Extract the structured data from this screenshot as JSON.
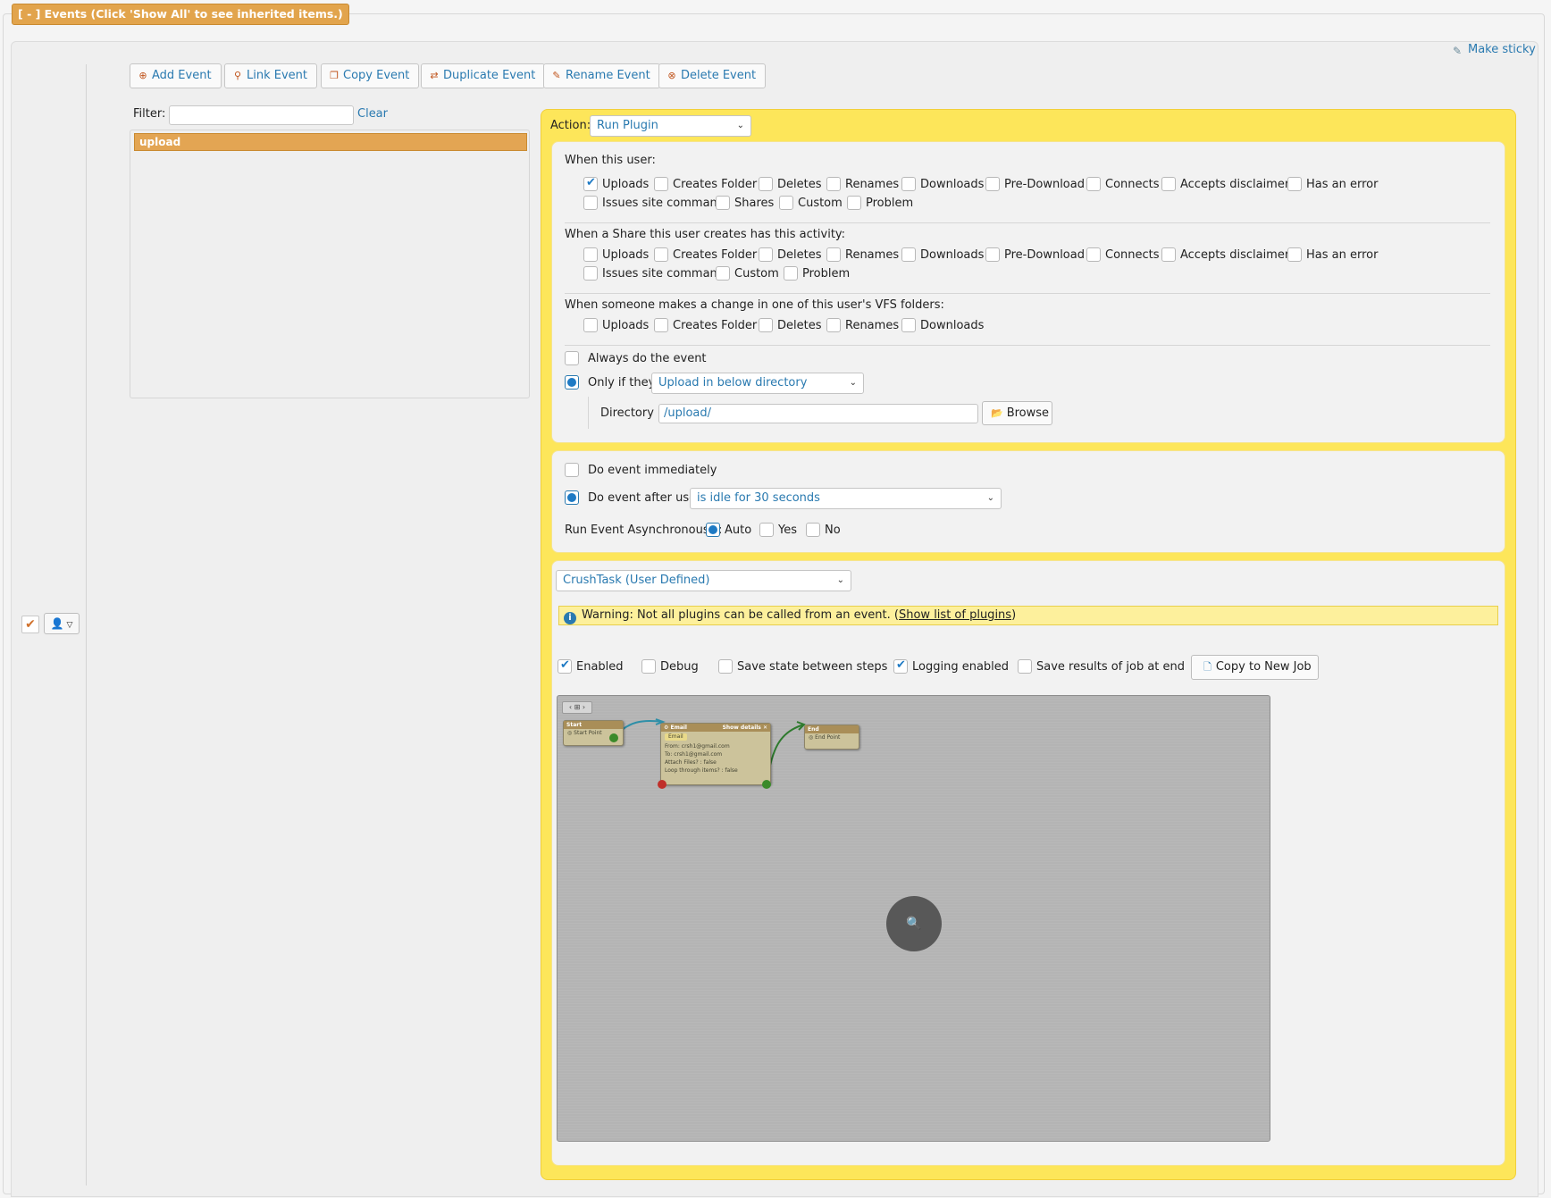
{
  "section": {
    "header": "[ - ] Events (Click 'Show All' to see inherited items.)",
    "make_sticky": "Make sticky"
  },
  "toolbar": {
    "add_event": "Add Event",
    "link_event": "Link Event",
    "copy_event": "Copy Event",
    "duplicate_event": "Duplicate Event",
    "rename_event": "Rename Event",
    "delete_event": "Delete Event"
  },
  "filter": {
    "label": "Filter:",
    "value": "",
    "clear": "Clear"
  },
  "events_list": [
    {
      "name": "upload",
      "selected": true
    }
  ],
  "action": {
    "label": "Action:",
    "value": "Run Plugin"
  },
  "trigger": {
    "user_title": "When this user:",
    "user_options": [
      {
        "label": "Uploads",
        "checked": true
      },
      {
        "label": "Creates Folder",
        "checked": false
      },
      {
        "label": "Deletes",
        "checked": false
      },
      {
        "label": "Renames",
        "checked": false
      },
      {
        "label": "Downloads",
        "checked": false
      },
      {
        "label": "Pre-Download",
        "checked": false
      },
      {
        "label": "Connects",
        "checked": false
      },
      {
        "label": "Accepts disclaimer",
        "checked": false
      },
      {
        "label": "Has an error",
        "checked": false
      },
      {
        "label": "Issues site command",
        "checked": false
      },
      {
        "label": "Shares",
        "checked": false
      },
      {
        "label": "Custom",
        "checked": false
      },
      {
        "label": "Problem",
        "checked": false
      }
    ],
    "share_title": "When a Share this user creates has this activity:",
    "share_options": [
      {
        "label": "Uploads",
        "checked": false
      },
      {
        "label": "Creates Folder",
        "checked": false
      },
      {
        "label": "Deletes",
        "checked": false
      },
      {
        "label": "Renames",
        "checked": false
      },
      {
        "label": "Downloads",
        "checked": false
      },
      {
        "label": "Pre-Download",
        "checked": false
      },
      {
        "label": "Connects",
        "checked": false
      },
      {
        "label": "Accepts disclaimer",
        "checked": false
      },
      {
        "label": "Has an error",
        "checked": false
      },
      {
        "label": "Issues site command",
        "checked": false
      },
      {
        "label": "Custom",
        "checked": false
      },
      {
        "label": "Problem",
        "checked": false
      }
    ],
    "vfs_title": "When someone makes a change in one of this user's VFS folders:",
    "vfs_options": [
      {
        "label": "Uploads",
        "checked": false
      },
      {
        "label": "Creates Folder",
        "checked": false
      },
      {
        "label": "Deletes",
        "checked": false
      },
      {
        "label": "Renames",
        "checked": false
      },
      {
        "label": "Downloads",
        "checked": false
      }
    ],
    "always_label": "Always do the event",
    "always_checked": false,
    "only_if_label": "Only if they",
    "only_if_checked": true,
    "only_if_value": "Upload in below directory",
    "directory_label": "Directory :",
    "directory_value": "/upload/",
    "browse_label": "Browse"
  },
  "timing": {
    "immediately_label": "Do event immediately",
    "immediately_checked": false,
    "after_label": "Do event after user",
    "after_checked": true,
    "after_value": "is idle for 30 seconds",
    "async_label": "Run Event Asynchronously:",
    "async_options": [
      {
        "label": "Auto",
        "checked": true
      },
      {
        "label": "Yes",
        "checked": false
      },
      {
        "label": "No",
        "checked": false
      }
    ]
  },
  "plugin": {
    "select_value": "CrushTask (User Defined)",
    "warning_text": "Warning: Not all plugins can be called from an event. (",
    "warning_link": "Show list of plugins",
    "warning_close": ")",
    "options": [
      {
        "label": "Enabled",
        "checked": true
      },
      {
        "label": "Debug",
        "checked": false
      },
      {
        "label": "Save state between steps",
        "checked": false
      },
      {
        "label": "Logging enabled",
        "checked": true
      },
      {
        "label": "Save results of job at end",
        "checked": false
      }
    ],
    "copy_job_label": "Copy to New Job"
  },
  "canvas": {
    "start_node": {
      "title": "Start",
      "item": "Start Point"
    },
    "email_node": {
      "title": "Email",
      "details": "Show details",
      "pill": "Email",
      "rows": [
        "From: crsh1@gmail.com",
        "To: crsh1@gmail.com",
        "Attach Files? : false",
        "Loop through items? : false"
      ]
    },
    "end_node": {
      "title": "End",
      "item": "End Point"
    }
  },
  "colors": {
    "accent": "#2a7ab0",
    "header_orange": "#e2a44c",
    "panel_yellow": "#fde65a"
  }
}
